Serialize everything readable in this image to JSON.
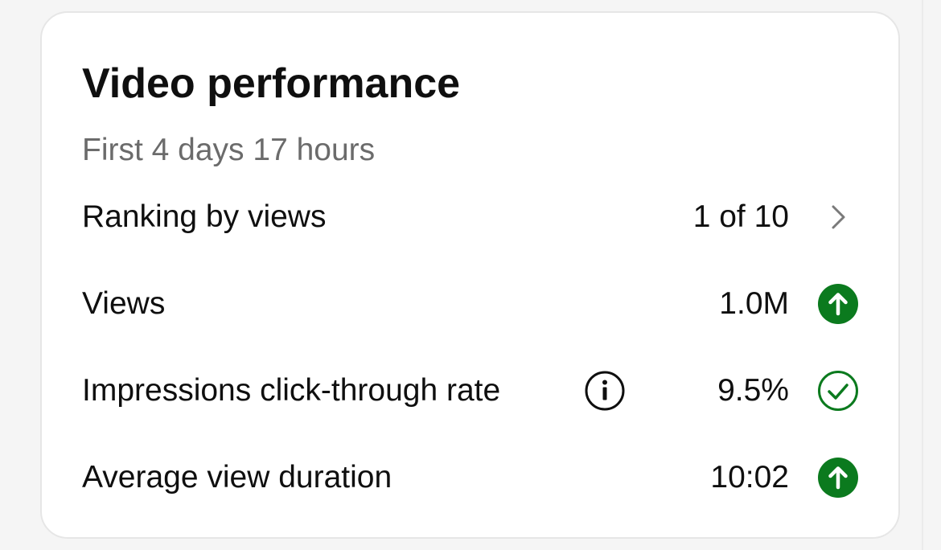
{
  "card": {
    "title": "Video performance",
    "subtitle": "First 4 days 17 hours"
  },
  "metrics": [
    {
      "label": "Ranking by views",
      "value": "1 of 10",
      "indicator": "chevron-right-icon"
    },
    {
      "label": "Views",
      "value": "1.0M",
      "indicator": "arrow-up-circle-icon"
    },
    {
      "label": "Impressions click-through rate",
      "value": "9.5%",
      "indicator": "check-circle-icon",
      "has_info": true
    },
    {
      "label": "Average view duration",
      "value": "10:02",
      "indicator": "arrow-up-circle-icon"
    }
  ],
  "colors": {
    "positive_green": "#0b7a1e",
    "text_primary": "#0f0f0f",
    "text_secondary": "#6b6b6b",
    "chevron_gray": "#7a7a7a",
    "card_background": "#ffffff",
    "page_background": "#f5f5f5"
  }
}
